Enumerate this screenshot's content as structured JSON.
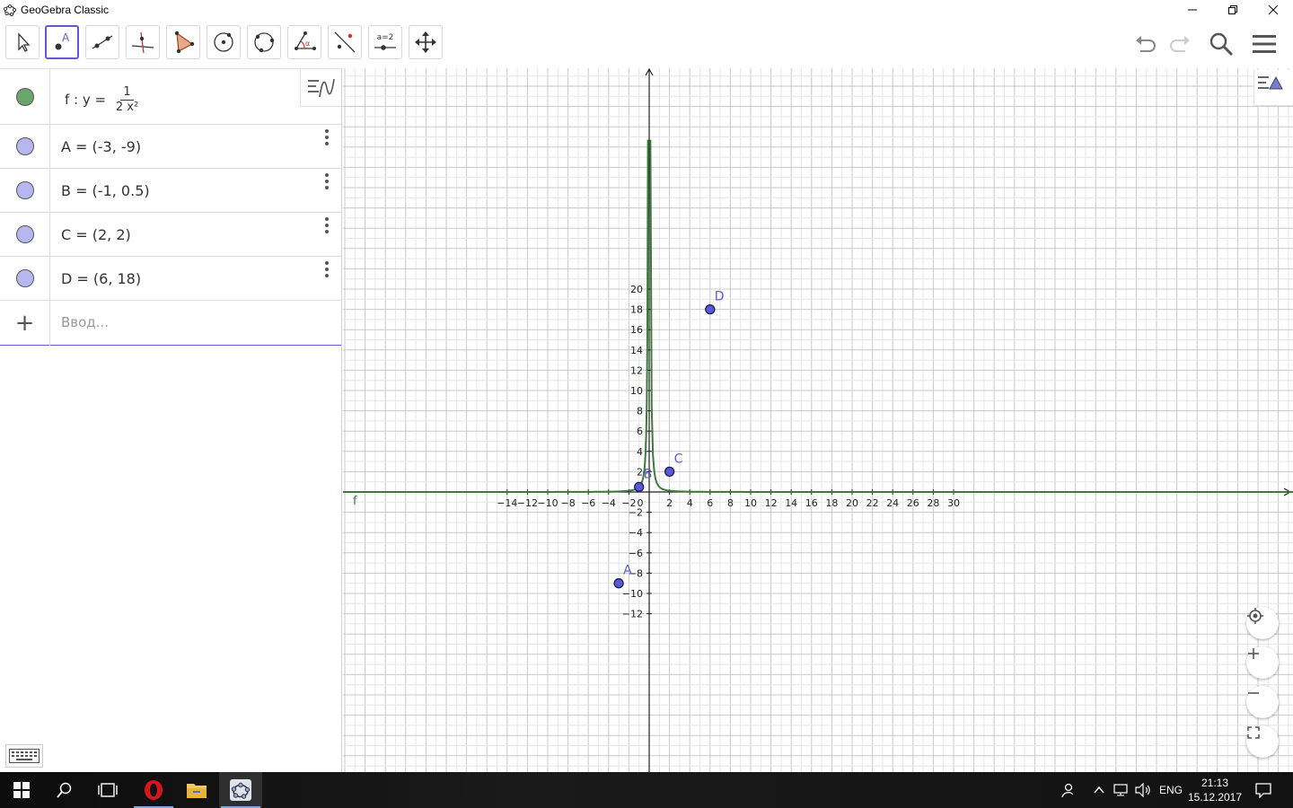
{
  "window": {
    "title": "GeoGebra Classic"
  },
  "toolbar": {
    "tools": [
      "move-tool",
      "point-tool",
      "line-tool",
      "perpendicular-line-tool",
      "polygon-tool",
      "circle-center-point-tool",
      "circle-three-points-tool",
      "angle-tool",
      "reflect-tool",
      "slider-tool",
      "move-graphics-view-tool"
    ],
    "active_tool": "point-tool",
    "slider_label": "a=2"
  },
  "algebra": {
    "function": {
      "prefix": "f : y =",
      "numerator": "1",
      "denominator": "2 x²",
      "color": "#6aa56a"
    },
    "points": [
      {
        "text": "A = (-3, -9)"
      },
      {
        "text": "B = (-1, 0.5)"
      },
      {
        "text": "C = (2, 2)"
      },
      {
        "text": "D = (6, 18)"
      }
    ],
    "point_color": "#b7b7f0",
    "input_placeholder": "Ввод..."
  },
  "graphics": {
    "x_ticks": [
      "-14",
      "-12",
      "-10",
      "-8",
      "-6",
      "-4",
      "-2",
      "0",
      "2",
      "4",
      "6",
      "8",
      "10",
      "12",
      "14",
      "16",
      "18",
      "20",
      "22",
      "24",
      "26",
      "28",
      "30"
    ],
    "y_ticks": [
      "20",
      "18",
      "16",
      "14",
      "12",
      "10",
      "8",
      "6",
      "4",
      "2",
      "-2",
      "-4",
      "-6",
      "-8",
      "-10",
      "-12"
    ],
    "points": [
      {
        "label": "A",
        "x": -3,
        "y": -9
      },
      {
        "label": "B",
        "x": -1,
        "y": 0.5
      },
      {
        "label": "C",
        "x": 2,
        "y": 2
      },
      {
        "label": "D",
        "x": 6,
        "y": 18
      }
    ],
    "function_label": "f",
    "curve_color": "#3e7a3e",
    "point_fill": "#5a5ad6"
  },
  "taskbar": {
    "apps": [
      "start",
      "search",
      "task-view",
      "opera",
      "file-explorer",
      "geogebra"
    ],
    "lang": "ENG",
    "time": "21:13",
    "date": "15.12.2017"
  }
}
